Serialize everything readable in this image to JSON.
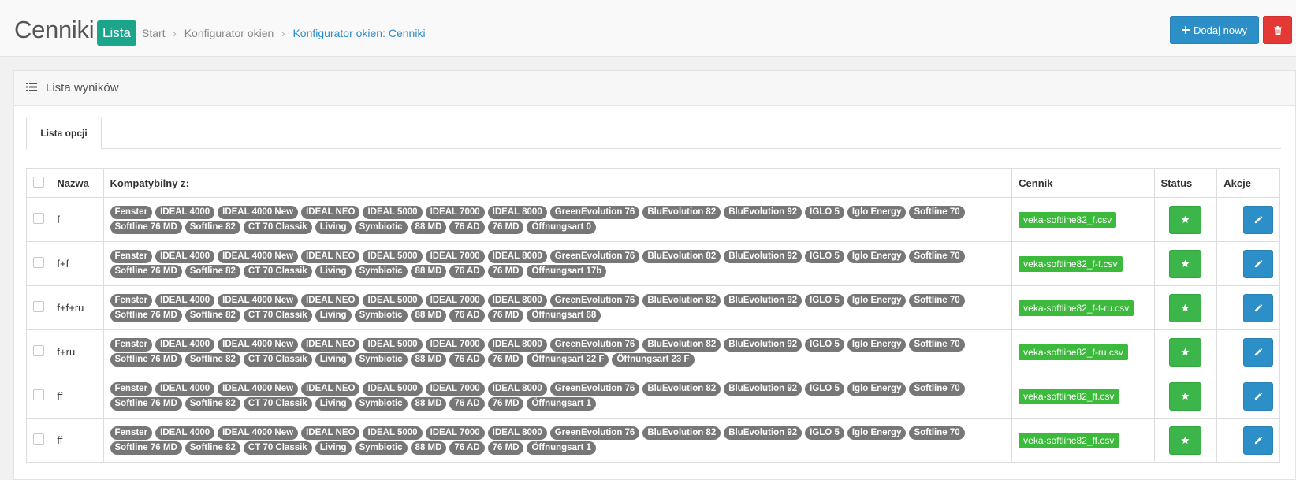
{
  "header": {
    "title": "Cenniki",
    "badge": "Lista",
    "breadcrumb": [
      "Start",
      "Konfigurator okien",
      "Konfigurator okien: Cenniki"
    ],
    "add_button": "Dodaj nowy"
  },
  "panel": {
    "title": "Lista wyników",
    "tab": "Lista opcji"
  },
  "table": {
    "columns": {
      "name": "Nazwa",
      "compatible": "Kompatybilny z:",
      "pricelist": "Cennik",
      "status": "Status",
      "actions": "Akcje"
    },
    "rows": [
      {
        "name": "f",
        "tags": [
          "Fenster",
          "IDEAL 4000",
          "IDEAL 4000 New",
          "IDEAL NEO",
          "IDEAL 5000",
          "IDEAL 7000",
          "IDEAL 8000",
          "GreenEvolution 76",
          "BluEvolution 82",
          "BluEvolution 92",
          "IGLO 5",
          "Iglo Energy",
          "Softline 70",
          "Softline 76 MD",
          "Softline 82",
          "CT 70 Classik",
          "Living",
          "Symbiotic",
          "88 MD",
          "76 AD",
          "76 MD",
          "Öffnungsart 0"
        ],
        "file": "veka-softline82_f.csv"
      },
      {
        "name": "f+f",
        "tags": [
          "Fenster",
          "IDEAL 4000",
          "IDEAL 4000 New",
          "IDEAL NEO",
          "IDEAL 5000",
          "IDEAL 7000",
          "IDEAL 8000",
          "GreenEvolution 76",
          "BluEvolution 82",
          "BluEvolution 92",
          "IGLO 5",
          "Iglo Energy",
          "Softline 70",
          "Softline 76 MD",
          "Softline 82",
          "CT 70 Classik",
          "Living",
          "Symbiotic",
          "88 MD",
          "76 AD",
          "76 MD",
          "Öffnungsart 17b"
        ],
        "file": "veka-softline82_f-f.csv"
      },
      {
        "name": "f+f+ru",
        "tags": [
          "Fenster",
          "IDEAL 4000",
          "IDEAL 4000 New",
          "IDEAL NEO",
          "IDEAL 5000",
          "IDEAL 7000",
          "IDEAL 8000",
          "GreenEvolution 76",
          "BluEvolution 82",
          "BluEvolution 92",
          "IGLO 5",
          "Iglo Energy",
          "Softline 70",
          "Softline 76 MD",
          "Softline 82",
          "CT 70 Classik",
          "Living",
          "Symbiotic",
          "88 MD",
          "76 AD",
          "76 MD",
          "Öffnungsart 68"
        ],
        "file": "veka-softline82_f-f-ru.csv"
      },
      {
        "name": "f+ru",
        "tags": [
          "Fenster",
          "IDEAL 4000",
          "IDEAL 4000 New",
          "IDEAL NEO",
          "IDEAL 5000",
          "IDEAL 7000",
          "IDEAL 8000",
          "GreenEvolution 76",
          "BluEvolution 82",
          "BluEvolution 92",
          "IGLO 5",
          "Iglo Energy",
          "Softline 70",
          "Softline 76 MD",
          "Softline 82",
          "CT 70 Classik",
          "Living",
          "Symbiotic",
          "88 MD",
          "76 AD",
          "76 MD",
          "Öffnungsart 22 F",
          "Öffnungsart 23 F"
        ],
        "file": "veka-softline82_f-ru.csv"
      },
      {
        "name": "ff",
        "tags": [
          "Fenster",
          "IDEAL 4000",
          "IDEAL 4000 New",
          "IDEAL NEO",
          "IDEAL 5000",
          "IDEAL 7000",
          "IDEAL 8000",
          "GreenEvolution 76",
          "BluEvolution 82",
          "BluEvolution 92",
          "IGLO 5",
          "Iglo Energy",
          "Softline 70",
          "Softline 76 MD",
          "Softline 82",
          "CT 70 Classik",
          "Living",
          "Symbiotic",
          "88 MD",
          "76 AD",
          "76 MD",
          "Öffnungsart 1"
        ],
        "file": "veka-softline82_ff.csv"
      },
      {
        "name": "ff",
        "tags": [
          "Fenster",
          "IDEAL 4000",
          "IDEAL 4000 New",
          "IDEAL NEO",
          "IDEAL 5000",
          "IDEAL 7000",
          "IDEAL 8000",
          "GreenEvolution 76",
          "BluEvolution 82",
          "BluEvolution 92",
          "IGLO 5",
          "Iglo Energy",
          "Softline 70",
          "Softline 76 MD",
          "Softline 82",
          "CT 70 Classik",
          "Living",
          "Symbiotic",
          "88 MD",
          "76 AD",
          "76 MD",
          "Öffnungsart 1"
        ],
        "file": "veka-softline82_ff.csv"
      }
    ]
  },
  "icons": {
    "add": "plus-icon",
    "delete": "trash-icon",
    "panel": "list-icon",
    "status": "star-icon",
    "edit": "pencil-icon"
  },
  "colors": {
    "primary": "#2d8fc8",
    "danger": "#e53935",
    "success": "#3cb54a",
    "badge_teal": "#1ba58b",
    "tag_gray": "#777777",
    "file_green": "#3cba3c"
  }
}
